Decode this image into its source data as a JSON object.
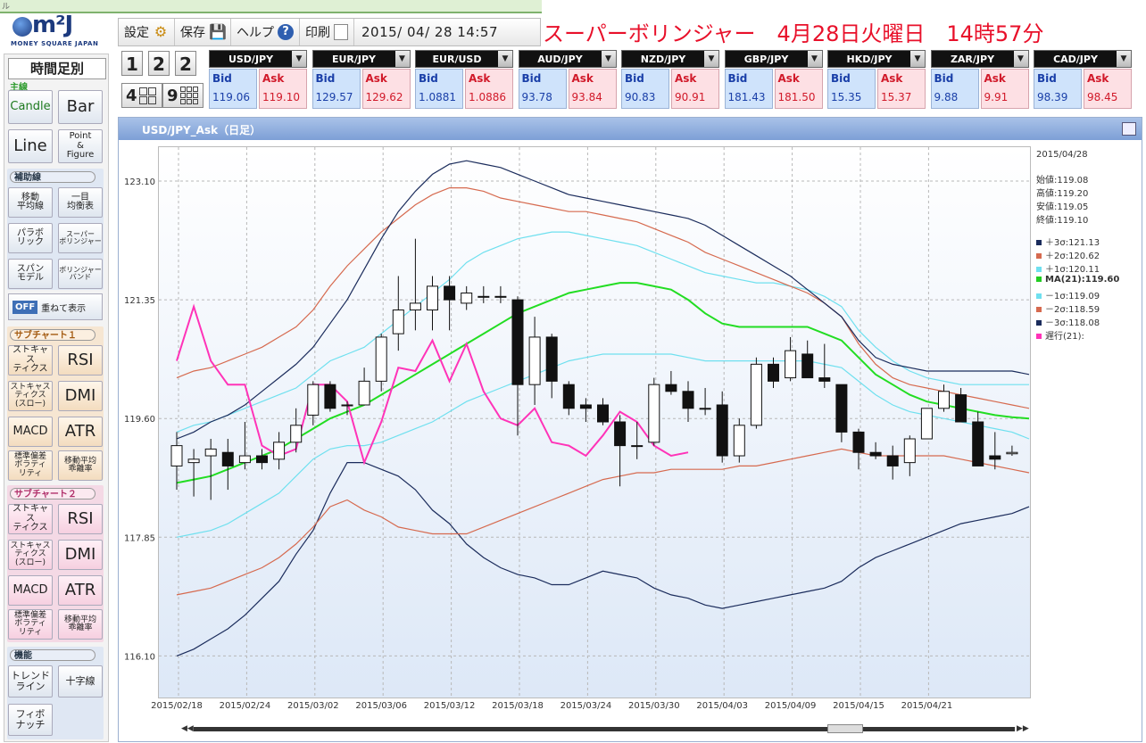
{
  "topbar": {
    "tiny_text": "ル"
  },
  "logo": {
    "main": "m²J",
    "sub": "MONEY SQUARE JAPAN"
  },
  "sidebar": {
    "title": "時間足別",
    "main_label": "主線",
    "main_buttons": [
      "Candle",
      "Bar",
      "Line",
      "Point\n&\nFigure"
    ],
    "aux_label": "補助線",
    "aux_buttons": [
      "移動\n平均線",
      "一目\n均衡表",
      "パラボ\nリック",
      "スーパー\nボリンジャー",
      "スパン\nモデル",
      "ボリンジャー\nバンド"
    ],
    "off_label": "OFF",
    "overlay_label": "重ねて表示",
    "sub1_label": "サブチャート１",
    "sub1_buttons": [
      "ストキャス\nティクス",
      "RSI",
      "ストキャス\nティクス\n(スロー)",
      "DMI",
      "MACD",
      "ATR",
      "標準偏差\nボラティ\nリティ",
      "移動平均\n乖離率"
    ],
    "sub2_label": "サブチャート２",
    "sub2_buttons": [
      "ストキャス\nティクス",
      "RSI",
      "ストキャス\nティクス\n(スロー)",
      "DMI",
      "MACD",
      "ATR",
      "標準偏差\nボラティ\nリティ",
      "移動平均\n乖離率"
    ],
    "func_label": "機能",
    "func_buttons": [
      "トレンド\nライン",
      "十字線",
      "フィボ\nナッチ"
    ]
  },
  "toolbar": {
    "settings": "設定",
    "save": "保存",
    "help": "ヘルプ",
    "print": "印刷",
    "datetime": "2015/ 04/ 28  14:57"
  },
  "headline": "スーパーボリンジャー　4月28日火曜日　14時57分",
  "layout_buttons": [
    "1",
    "2",
    "2",
    "4",
    "9"
  ],
  "quotes": [
    {
      "pair": "USD/JPY",
      "bid": "119.06",
      "ask": "119.10"
    },
    {
      "pair": "EUR/JPY",
      "bid": "129.57",
      "ask": "129.62"
    },
    {
      "pair": "EUR/USD",
      "bid": "1.0881",
      "ask": "1.0886"
    },
    {
      "pair": "AUD/JPY",
      "bid": "93.78",
      "ask": "93.84"
    },
    {
      "pair": "NZD/JPY",
      "bid": "90.83",
      "ask": "90.91"
    },
    {
      "pair": "GBP/JPY",
      "bid": "181.43",
      "ask": "181.50"
    },
    {
      "pair": "HKD/JPY",
      "bid": "15.35",
      "ask": "15.37"
    },
    {
      "pair": "ZAR/JPY",
      "bid": "9.88",
      "ask": "9.91"
    },
    {
      "pair": "CAD/JPY",
      "bid": "98.39",
      "ask": "98.45"
    }
  ],
  "quote_labels": {
    "bid": "Bid",
    "ask": "Ask"
  },
  "chart_panel": {
    "title": "USD/JPY_Ask（日足）"
  },
  "legend": {
    "date": "2015/04/28",
    "open": "始値:119.08",
    "high": "高値:119.20",
    "low": "安値:119.05",
    "close": "終値:119.10",
    "items": [
      {
        "label": "＋3σ:121.13",
        "color": "#1b2c5c"
      },
      {
        "label": "＋2σ:120.62",
        "color": "#d66a4f"
      },
      {
        "label": "＋1σ:120.11",
        "color": "#6fe0ef"
      },
      {
        "label": "MA(21):119.60",
        "color": "#22cc22"
      },
      {
        "label": "－1σ:119.09",
        "color": "#6fe0ef"
      },
      {
        "label": "－2σ:118.59",
        "color": "#d66a4f"
      },
      {
        "label": "－3σ:118.08",
        "color": "#1b2c5c"
      },
      {
        "label": "遅行(21):",
        "color": "#ff33b8"
      }
    ]
  },
  "chart_data": {
    "type": "line",
    "ylim": [
      115.5,
      123.6
    ],
    "yticks": [
      "123.10",
      "121.35",
      "119.60",
      "117.85",
      "116.10"
    ],
    "ytick_values": [
      123.1,
      121.35,
      119.6,
      117.85,
      116.1
    ],
    "xtick_labels": [
      "2015/02/18",
      "2015/02/24",
      "2015/03/02",
      "2015/03/06",
      "2015/03/12",
      "2015/03/18",
      "2015/03/24",
      "2015/03/30",
      "2015/04/03",
      "2015/04/09",
      "2015/04/15",
      "2015/04/21"
    ],
    "xtick_index": [
      0,
      4,
      8,
      12,
      16,
      20,
      24,
      28,
      32,
      36,
      40,
      44
    ],
    "candles": [
      {
        "o": 118.9,
        "h": 119.4,
        "l": 118.55,
        "c": 119.2
      },
      {
        "o": 118.95,
        "h": 119.15,
        "l": 118.45,
        "c": 119.0
      },
      {
        "o": 119.05,
        "h": 119.3,
        "l": 118.4,
        "c": 119.15
      },
      {
        "o": 119.1,
        "h": 119.3,
        "l": 118.55,
        "c": 118.9
      },
      {
        "o": 118.95,
        "h": 119.55,
        "l": 118.85,
        "c": 119.05
      },
      {
        "o": 119.05,
        "h": 119.15,
        "l": 118.85,
        "c": 118.95
      },
      {
        "o": 119.0,
        "h": 119.4,
        "l": 118.85,
        "c": 119.25
      },
      {
        "o": 119.25,
        "h": 119.75,
        "l": 119.1,
        "c": 119.5
      },
      {
        "o": 119.65,
        "h": 120.15,
        "l": 119.5,
        "c": 120.1
      },
      {
        "o": 120.1,
        "h": 120.15,
        "l": 119.7,
        "c": 119.75
      },
      {
        "o": 119.8,
        "h": 119.85,
        "l": 119.65,
        "c": 119.8
      },
      {
        "o": 119.8,
        "h": 120.35,
        "l": 119.8,
        "c": 120.15
      },
      {
        "o": 120.15,
        "h": 120.85,
        "l": 120.0,
        "c": 120.8
      },
      {
        "o": 120.85,
        "h": 121.7,
        "l": 120.6,
        "c": 121.2
      },
      {
        "o": 121.2,
        "h": 122.25,
        "l": 120.9,
        "c": 121.3
      },
      {
        "o": 121.2,
        "h": 121.7,
        "l": 120.9,
        "c": 121.55
      },
      {
        "o": 121.55,
        "h": 121.7,
        "l": 120.9,
        "c": 121.35
      },
      {
        "o": 121.3,
        "h": 121.55,
        "l": 121.2,
        "c": 121.45
      },
      {
        "o": 121.4,
        "h": 121.55,
        "l": 121.3,
        "c": 121.4
      },
      {
        "o": 121.4,
        "h": 121.55,
        "l": 121.3,
        "c": 121.4
      },
      {
        "o": 121.35,
        "h": 121.4,
        "l": 119.35,
        "c": 120.1
      },
      {
        "o": 120.1,
        "h": 121.1,
        "l": 119.8,
        "c": 120.8
      },
      {
        "o": 120.8,
        "h": 120.85,
        "l": 119.9,
        "c": 120.15
      },
      {
        "o": 120.1,
        "h": 120.15,
        "l": 119.65,
        "c": 119.75
      },
      {
        "o": 119.8,
        "h": 119.9,
        "l": 119.55,
        "c": 119.75
      },
      {
        "o": 119.8,
        "h": 119.9,
        "l": 119.5,
        "c": 119.55
      },
      {
        "o": 119.55,
        "h": 119.65,
        "l": 118.6,
        "c": 119.2
      },
      {
        "o": 119.2,
        "h": 119.55,
        "l": 119.0,
        "c": 119.2
      },
      {
        "o": 119.25,
        "h": 120.2,
        "l": 119.2,
        "c": 120.1
      },
      {
        "o": 120.1,
        "h": 120.3,
        "l": 119.95,
        "c": 120.0
      },
      {
        "o": 120.0,
        "h": 120.15,
        "l": 119.55,
        "c": 119.75
      },
      {
        "o": 119.75,
        "h": 120.05,
        "l": 119.65,
        "c": 119.75
      },
      {
        "o": 119.8,
        "h": 120.0,
        "l": 118.95,
        "c": 119.05
      },
      {
        "o": 119.05,
        "h": 119.6,
        "l": 118.95,
        "c": 119.5
      },
      {
        "o": 119.5,
        "h": 120.5,
        "l": 119.45,
        "c": 120.4
      },
      {
        "o": 120.4,
        "h": 120.5,
        "l": 120.05,
        "c": 120.15
      },
      {
        "o": 120.2,
        "h": 120.8,
        "l": 120.15,
        "c": 120.6
      },
      {
        "o": 120.55,
        "h": 120.75,
        "l": 120.2,
        "c": 120.2
      },
      {
        "o": 120.2,
        "h": 120.7,
        "l": 120.05,
        "c": 120.15
      },
      {
        "o": 120.1,
        "h": 120.1,
        "l": 119.25,
        "c": 119.4
      },
      {
        "o": 119.4,
        "h": 119.45,
        "l": 118.85,
        "c": 119.1
      },
      {
        "o": 119.1,
        "h": 119.25,
        "l": 119.0,
        "c": 119.05
      },
      {
        "o": 119.05,
        "h": 119.2,
        "l": 118.7,
        "c": 118.9
      },
      {
        "o": 118.95,
        "h": 119.35,
        "l": 118.75,
        "c": 119.3
      },
      {
        "o": 119.3,
        "h": 119.75,
        "l": 119.3,
        "c": 119.75
      },
      {
        "o": 119.75,
        "h": 120.1,
        "l": 119.7,
        "c": 120.0
      },
      {
        "o": 119.95,
        "h": 120.05,
        "l": 119.55,
        "c": 119.55
      },
      {
        "o": 119.55,
        "h": 119.7,
        "l": 118.95,
        "c": 118.9
      },
      {
        "o": 119.05,
        "h": 119.4,
        "l": 118.85,
        "c": 119.0
      },
      {
        "o": 119.08,
        "h": 119.2,
        "l": 119.05,
        "c": 119.1
      }
    ],
    "series": [
      {
        "key": "p3",
        "color": "#1b2c5c",
        "values": [
          116.1,
          116.2,
          116.35,
          116.5,
          116.7,
          116.95,
          117.2,
          117.6,
          117.95,
          118.5,
          118.95,
          118.95,
          118.85,
          118.75,
          118.55,
          118.25,
          118.05,
          117.75,
          117.55,
          117.4,
          117.3,
          117.25,
          117.15,
          117.15,
          117.25,
          117.35,
          117.3,
          117.25,
          117.1,
          117.0,
          116.95,
          116.85,
          116.8,
          116.85,
          116.9,
          116.95,
          117.0,
          117.05,
          117.1,
          117.2,
          117.4,
          117.55,
          117.65,
          117.75,
          117.85,
          117.95,
          118.05,
          118.1,
          118.15,
          118.2,
          118.3
        ]
      },
      {
        "key": "p2",
        "color": "#d66a4f",
        "values": [
          117.0,
          117.05,
          117.1,
          117.2,
          117.3,
          117.4,
          117.55,
          117.75,
          118.0,
          118.3,
          118.4,
          118.25,
          118.15,
          118.0,
          117.95,
          117.9,
          117.9,
          117.9,
          118.0,
          118.1,
          118.2,
          118.3,
          118.4,
          118.5,
          118.6,
          118.7,
          118.75,
          118.8,
          118.8,
          118.85,
          118.85,
          118.85,
          118.85,
          118.9,
          118.9,
          118.95,
          119.0,
          119.05,
          119.1,
          119.15,
          119.1,
          119.05,
          119.05,
          119.05,
          119.05,
          119.05,
          119.0,
          118.95,
          118.9,
          118.85,
          118.8
        ]
      },
      {
        "key": "p1",
        "color": "#6fe0ef",
        "values": [
          117.85,
          117.9,
          117.95,
          118.05,
          118.2,
          118.35,
          118.5,
          118.75,
          119.0,
          119.15,
          119.2,
          119.2,
          119.25,
          119.35,
          119.45,
          119.55,
          119.7,
          119.85,
          119.95,
          120.05,
          120.15,
          120.25,
          120.35,
          120.45,
          120.5,
          120.55,
          120.55,
          120.55,
          120.55,
          120.55,
          120.5,
          120.45,
          120.45,
          120.45,
          120.45,
          120.45,
          120.45,
          120.45,
          120.4,
          120.35,
          120.15,
          119.95,
          119.8,
          119.7,
          119.65,
          119.6,
          119.55,
          119.5,
          119.45,
          119.4,
          119.3
        ]
      },
      {
        "key": "ma",
        "color": "#22dd22",
        "values": [
          118.65,
          118.7,
          118.75,
          118.85,
          118.95,
          119.05,
          119.15,
          119.3,
          119.45,
          119.6,
          119.7,
          119.8,
          119.95,
          120.1,
          120.25,
          120.4,
          120.55,
          120.7,
          120.85,
          121.0,
          121.15,
          121.25,
          121.35,
          121.45,
          121.5,
          121.55,
          121.6,
          121.6,
          121.55,
          121.5,
          121.35,
          121.15,
          121.0,
          120.95,
          120.95,
          120.95,
          120.95,
          120.95,
          120.85,
          120.75,
          120.5,
          120.25,
          120.1,
          119.95,
          119.85,
          119.8,
          119.75,
          119.7,
          119.65,
          119.62,
          119.6
        ]
      },
      {
        "key": "m1",
        "color": "#6fe0ef",
        "values": [
          119.4,
          119.5,
          119.55,
          119.65,
          119.75,
          119.85,
          119.95,
          120.05,
          120.25,
          120.45,
          120.55,
          120.65,
          120.85,
          121.05,
          121.25,
          121.45,
          121.65,
          121.9,
          122.05,
          122.15,
          122.25,
          122.3,
          122.35,
          122.35,
          122.3,
          122.25,
          122.2,
          122.15,
          122.05,
          121.95,
          121.85,
          121.75,
          121.7,
          121.65,
          121.6,
          121.6,
          121.55,
          121.5,
          121.4,
          121.25,
          120.9,
          120.65,
          120.45,
          120.3,
          120.2,
          120.15,
          120.1,
          120.1,
          120.1,
          120.1,
          120.1
        ]
      },
      {
        "key": "m2",
        "color": "#d66a4f",
        "values": [
          120.2,
          120.3,
          120.35,
          120.45,
          120.55,
          120.65,
          120.8,
          120.95,
          121.2,
          121.55,
          121.85,
          122.1,
          122.35,
          122.55,
          122.75,
          122.9,
          123.0,
          123.0,
          122.95,
          122.85,
          122.8,
          122.75,
          122.7,
          122.65,
          122.65,
          122.6,
          122.55,
          122.5,
          122.4,
          122.3,
          122.2,
          122.05,
          121.95,
          121.85,
          121.75,
          121.65,
          121.55,
          121.45,
          121.3,
          121.1,
          120.7,
          120.4,
          120.2,
          120.1,
          120.05,
          120.0,
          119.95,
          119.9,
          119.85,
          119.8,
          119.75
        ]
      },
      {
        "key": "m3",
        "color": "#1b2c5c",
        "values": [
          119.3,
          119.4,
          119.55,
          119.65,
          119.8,
          120.0,
          120.2,
          120.4,
          120.65,
          121.0,
          121.35,
          121.8,
          122.25,
          122.65,
          122.95,
          123.2,
          123.35,
          123.4,
          123.35,
          123.3,
          123.2,
          123.1,
          123.0,
          122.9,
          122.85,
          122.8,
          122.75,
          122.7,
          122.65,
          122.6,
          122.55,
          122.45,
          122.3,
          122.15,
          122.0,
          121.85,
          121.7,
          121.5,
          121.3,
          121.1,
          120.75,
          120.5,
          120.4,
          120.35,
          120.3,
          120.3,
          120.3,
          120.3,
          120.3,
          120.3,
          120.25
        ]
      },
      {
        "key": "lag",
        "color": "#ff33b8",
        "values": [
          120.45,
          121.25,
          120.45,
          120.1,
          120.1,
          119.2,
          119.05,
          119.15,
          120.1,
          120.1,
          119.85,
          118.95,
          119.55,
          120.35,
          120.3,
          120.75,
          120.15,
          120.7,
          120.0,
          119.6,
          119.5,
          119.75,
          119.25,
          119.2,
          119.05,
          119.35,
          119.7,
          119.55,
          119.2,
          119.05,
          119.1
        ]
      }
    ]
  }
}
